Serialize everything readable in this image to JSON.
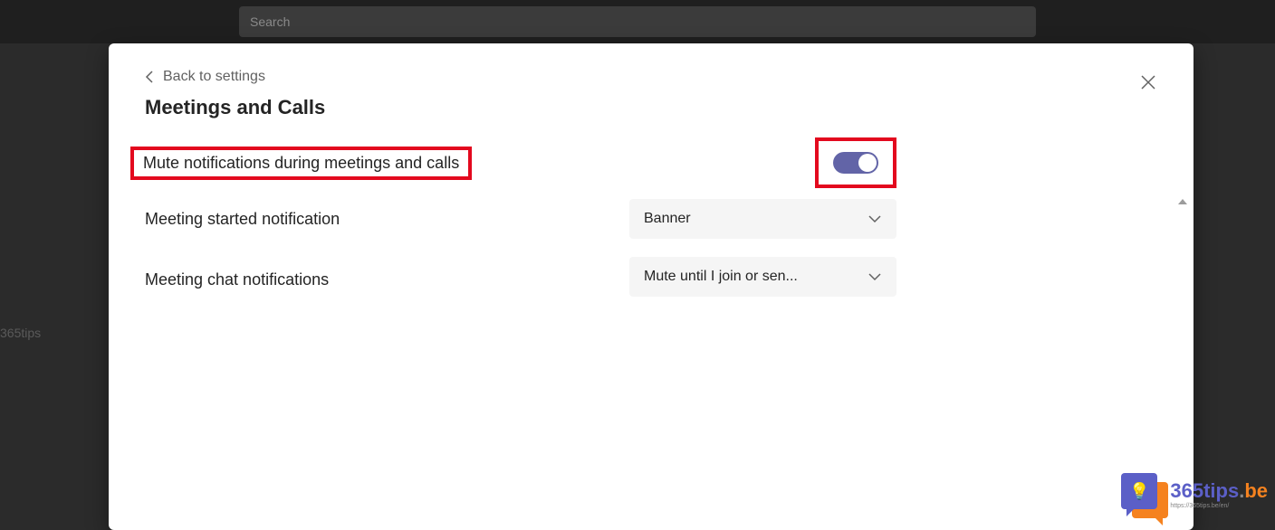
{
  "topbar": {
    "search_placeholder": "Search"
  },
  "bg": {
    "line1": "",
    "line2": "365tips"
  },
  "dialog": {
    "back_label": "Back to settings",
    "title": "Meetings and Calls",
    "rows": [
      {
        "label": "Mute notifications during meetings and calls",
        "control_type": "toggle",
        "toggle_on": true,
        "highlighted": true
      },
      {
        "label": "Meeting started notification",
        "control_type": "dropdown",
        "value": "Banner"
      },
      {
        "label": "Meeting chat notifications",
        "control_type": "dropdown",
        "value": "Mute until I join or sen..."
      }
    ]
  },
  "watermark": {
    "brand": "365tips",
    "suffix": "be",
    "url": "https://365tips.be/en/"
  },
  "colors": {
    "accent": "#6264a7",
    "highlight_red": "#e3091e",
    "orange": "#f5821f"
  }
}
